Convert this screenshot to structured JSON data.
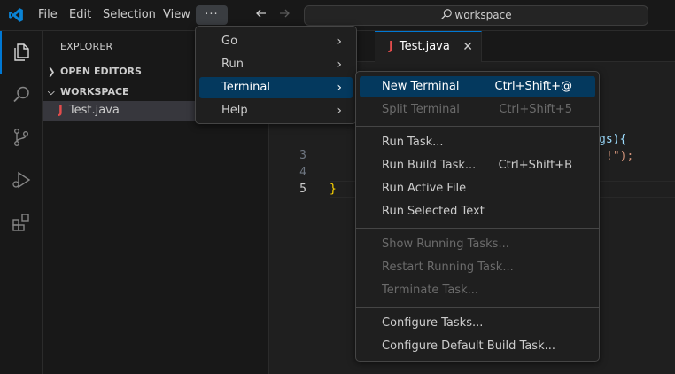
{
  "titlebar": {
    "menus": [
      "File",
      "Edit",
      "Selection",
      "View"
    ],
    "more_label": "···",
    "search_text": "workspace"
  },
  "explorer": {
    "title": "EXPLORER",
    "open_editors": "OPEN EDITORS",
    "workspace": "WORKSPACE",
    "file": "Test.java",
    "file_icon": "J"
  },
  "editor": {
    "tab_label": "Test.java",
    "tab_icon": "J",
    "close_glyph": "✕",
    "lines": [
      {
        "num": "3",
        "text": ""
      },
      {
        "num": "4",
        "text": ""
      },
      {
        "num": "5",
        "text": "}"
      }
    ],
    "fragment_1": "gs){",
    "fragment_2": "!\");"
  },
  "more_menu": {
    "items": [
      {
        "label": "Go"
      },
      {
        "label": "Run"
      },
      {
        "label": "Terminal"
      },
      {
        "label": "Help"
      }
    ]
  },
  "terminal_menu": {
    "items": [
      {
        "label": "New Terminal",
        "shortcut": "Ctrl+Shift+@"
      },
      {
        "label": "Split Terminal",
        "shortcut": "Ctrl+Shift+5"
      },
      {
        "label": "Run Task...",
        "shortcut": ""
      },
      {
        "label": "Run Build Task...",
        "shortcut": "Ctrl+Shift+B"
      },
      {
        "label": "Run Active File",
        "shortcut": ""
      },
      {
        "label": "Run Selected Text",
        "shortcut": ""
      },
      {
        "label": "Show Running Tasks...",
        "shortcut": ""
      },
      {
        "label": "Restart Running Task...",
        "shortcut": ""
      },
      {
        "label": "Terminate Task...",
        "shortcut": ""
      },
      {
        "label": "Configure Tasks...",
        "shortcut": ""
      },
      {
        "label": "Configure Default Build Task...",
        "shortcut": ""
      }
    ]
  },
  "colors": {
    "accent": "#0078d4",
    "highlight": "#04395e",
    "java_icon": "#e34c4c",
    "brace": "#ffd700"
  }
}
